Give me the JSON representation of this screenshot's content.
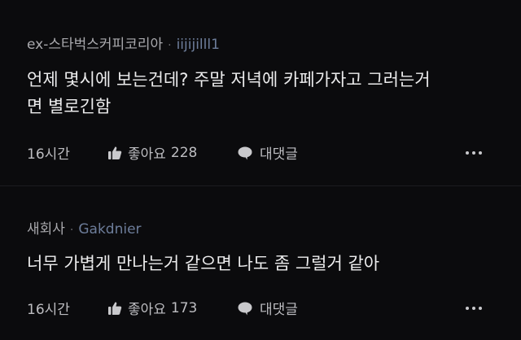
{
  "comments": [
    {
      "company": "ex-스타벅스커피코리아",
      "separator": "·",
      "nickname": "iijijilll1",
      "lines": [
        "언제 몇시에 보는건데? 주말 저녁에 카페가자고 그러는거",
        "면 별로긴함"
      ],
      "time": "16시간",
      "like_label": "좋아요",
      "like_count": "228",
      "reply_label": "대댓글",
      "like_icon": "thumbs-up-icon",
      "reply_icon": "speech-bubble-icon",
      "more_icon": "more-dots-icon"
    },
    {
      "company": "새회사",
      "separator": "·",
      "nickname": "Gakdnier",
      "lines": [
        "너무 가볍게 만나는거 같으면 나도 좀 그럴거 같아"
      ],
      "time": "16시간",
      "like_label": "좋아요",
      "like_count": "173",
      "reply_label": "대댓글",
      "like_icon": "thumbs-up-icon",
      "reply_icon": "speech-bubble-icon",
      "more_icon": "more-dots-icon"
    }
  ],
  "colors": {
    "background": "#0b0b0d",
    "nickname": "#6d7d9a",
    "text": "#ececed",
    "muted": "#bdbdc1"
  }
}
